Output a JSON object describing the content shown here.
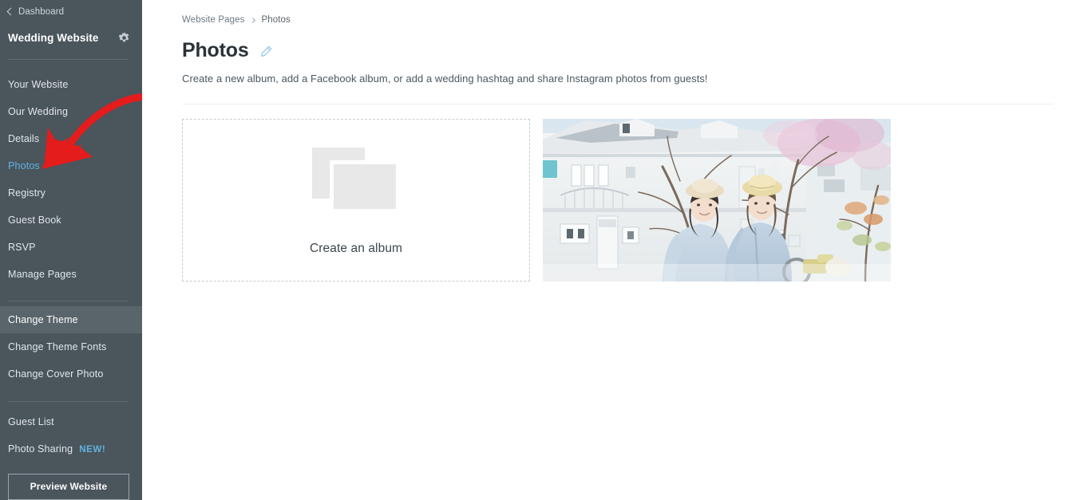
{
  "sidebar": {
    "back_link": {
      "label": "Dashboard",
      "icon": "chevron-left-icon"
    },
    "site_title": "Wedding Website",
    "settings_icon": "gear-icon",
    "nav_primary": [
      {
        "label": "Your Website",
        "state": "default"
      },
      {
        "label": "Our Wedding",
        "state": "default"
      },
      {
        "label": "Details",
        "state": "default"
      },
      {
        "label": "Photos",
        "state": "active"
      },
      {
        "label": "Registry",
        "state": "default"
      },
      {
        "label": "Guest Book",
        "state": "default"
      },
      {
        "label": "RSVP",
        "state": "default"
      },
      {
        "label": "Manage Pages",
        "state": "default"
      }
    ],
    "nav_theme": [
      {
        "label": "Change Theme",
        "state": "highlight"
      },
      {
        "label": "Change Theme Fonts",
        "state": "default"
      },
      {
        "label": "Change Cover Photo",
        "state": "default"
      }
    ],
    "nav_tools": [
      {
        "label": "Guest List",
        "badge": ""
      },
      {
        "label": "Photo Sharing",
        "badge": "NEW!"
      }
    ],
    "preview_button": "Preview Website"
  },
  "main": {
    "breadcrumb": [
      {
        "label": "Website Pages"
      },
      {
        "label": "Photos"
      }
    ],
    "title": "Photos",
    "edit_icon": "pencil-edit-icon",
    "description": "Create a new album, add a Facebook album, or add a wedding hashtag and share Instagram photos from guests!",
    "cards": {
      "create_album": {
        "label": "Create an album",
        "icon": "photo-stack-icon"
      },
      "photo_album": {
        "alt": "couple-photo-thumbnail"
      }
    }
  },
  "annotation": {
    "type": "red-arrow",
    "points_to": "Photos",
    "color": "#e51c1c"
  },
  "colors": {
    "sidebar_bg": "#4a555c",
    "sidebar_highlight": "#59646b",
    "accent_blue": "#62b2e3",
    "text_dark": "#2b3338",
    "annotation_red": "#e51c1c"
  }
}
